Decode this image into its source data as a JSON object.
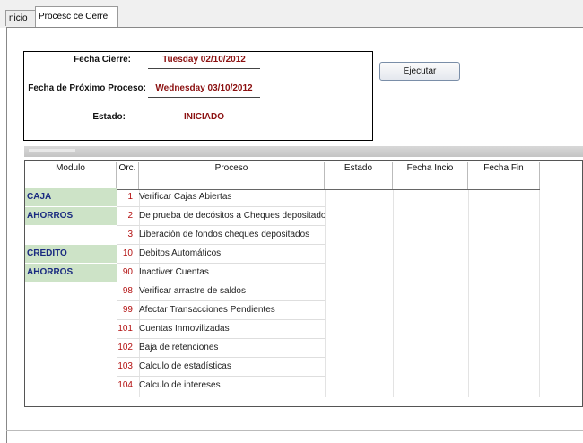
{
  "tabs": [
    {
      "label": "nicio"
    },
    {
      "label": "Procesc ce Cerre"
    }
  ],
  "info": {
    "fecha_cierre_label": "Fecha Cierre:",
    "fecha_cierre_value": "Tuesday 02/10/2012",
    "fecha_proximo_label": "Fecha de Próximo Proceso:",
    "fecha_proximo_value": "Wednesday 03/10/2012",
    "estado_label": "Estado:",
    "estado_value": "INICIADO"
  },
  "ejecutar_label": "Ejecutar",
  "grid": {
    "headers": {
      "modulo": "Modulo",
      "orc": "Orc.",
      "proceso": "Proceso",
      "estado": "Estado",
      "fecha_inicio": "Fecha Incio",
      "fecha_fin": "Fecha Fin"
    },
    "modules": [
      "CAJA",
      "AHORROS",
      "CREDITO",
      "AHORROS"
    ],
    "rows": [
      {
        "orc": "1",
        "proceso": "Verificar Cajas Abiertas"
      },
      {
        "orc": "2",
        "proceso": "De prueba de decósitos a Cheques depositados"
      },
      {
        "orc": "3",
        "proceso": "Liberación de fondos cheques depositados"
      },
      {
        "orc": "10",
        "proceso": "Debitos Automáticos"
      },
      {
        "orc": "90",
        "proceso": "Inactiver Cuentas"
      },
      {
        "orc": "98",
        "proceso": "Verificar arrastre de saldos"
      },
      {
        "orc": "99",
        "proceso": "Afectar Transacciones Pendientes"
      },
      {
        "orc": "101",
        "proceso": "Cuentas Inmovilizadas"
      },
      {
        "orc": "102",
        "proceso": "Baja de retenciones"
      },
      {
        "orc": "103",
        "proceso": "Calculo de estadísticas"
      },
      {
        "orc": "104",
        "proceso": "Calculo de intereses"
      }
    ]
  }
}
